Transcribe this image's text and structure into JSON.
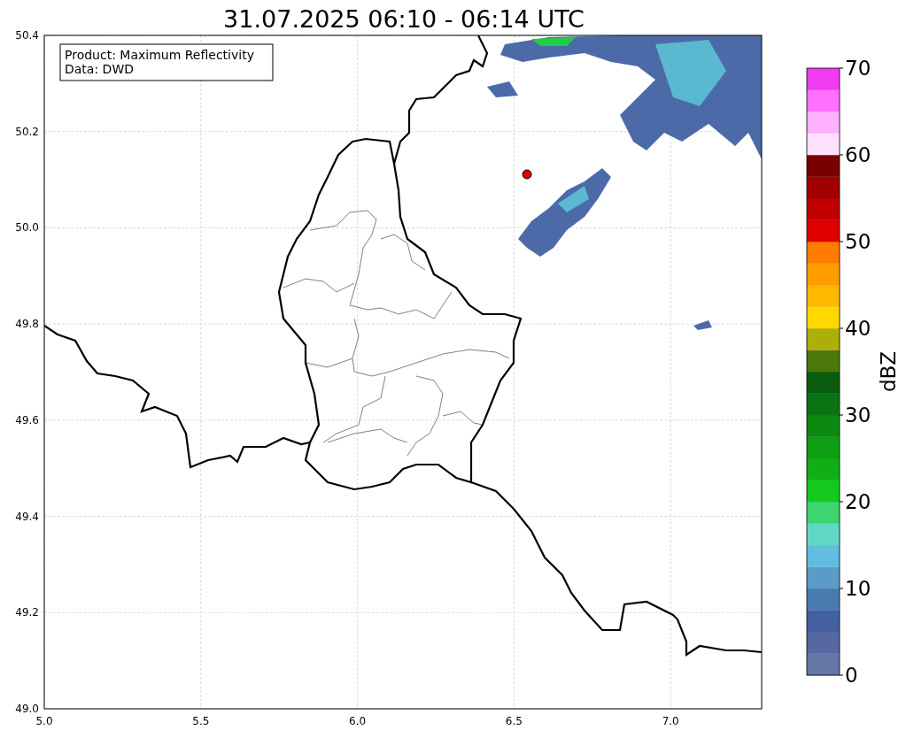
{
  "title": "31.07.2025 06:10 - 06:14 UTC",
  "map": {
    "legend": [
      "Product: Maximum Reflectivity",
      "Data: DWD"
    ],
    "x_ticks": [
      "5.0",
      "5.5",
      "6.0",
      "6.5",
      "7.0"
    ],
    "y_ticks": [
      "50.4",
      "50.2",
      "50.0",
      "49.8",
      "49.6",
      "49.4",
      "49.2",
      "49.0"
    ]
  },
  "colorbar": {
    "label": "dBZ",
    "ticks": [
      "70",
      "60",
      "50",
      "40",
      "30",
      "20",
      "10",
      "0"
    ],
    "bands": [
      {
        "color": "#6577a6"
      },
      {
        "color": "#5568a0"
      },
      {
        "color": "#4361a0"
      },
      {
        "color": "#4a7ab0"
      },
      {
        "color": "#5a9bc8"
      },
      {
        "color": "#62bde0"
      },
      {
        "color": "#60d8c4"
      },
      {
        "color": "#3ed470"
      },
      {
        "color": "#14c81e"
      },
      {
        "color": "#10b014"
      },
      {
        "color": "#0e9e12"
      },
      {
        "color": "#0c8a10"
      },
      {
        "color": "#0a7410"
      },
      {
        "color": "#0a5c0e"
      },
      {
        "color": "#4a780a"
      },
      {
        "color": "#acae0a"
      },
      {
        "color": "#ffd800"
      },
      {
        "color": "#ffb800"
      },
      {
        "color": "#ff9c00"
      },
      {
        "color": "#ff7c00"
      },
      {
        "color": "#e00000"
      },
      {
        "color": "#c00000"
      },
      {
        "color": "#a00000"
      },
      {
        "color": "#780000"
      },
      {
        "color": "#ffe0ff"
      },
      {
        "color": "#ffb0ff"
      },
      {
        "color": "#ff70ff"
      },
      {
        "color": "#ee3cee"
      }
    ]
  }
}
